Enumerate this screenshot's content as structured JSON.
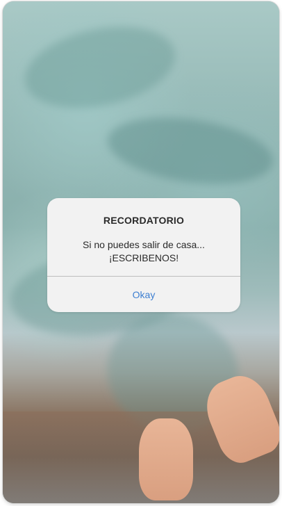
{
  "alert": {
    "title": "RECORDATORIO",
    "message_line1": "Si no puedes salir de casa...",
    "message_line2": "¡ESCRIBENOS!",
    "button_label": "Okay"
  },
  "colors": {
    "dialog_background": "#f2f2f2",
    "button_text": "#3d7fd1",
    "text": "#2a2a2a"
  }
}
